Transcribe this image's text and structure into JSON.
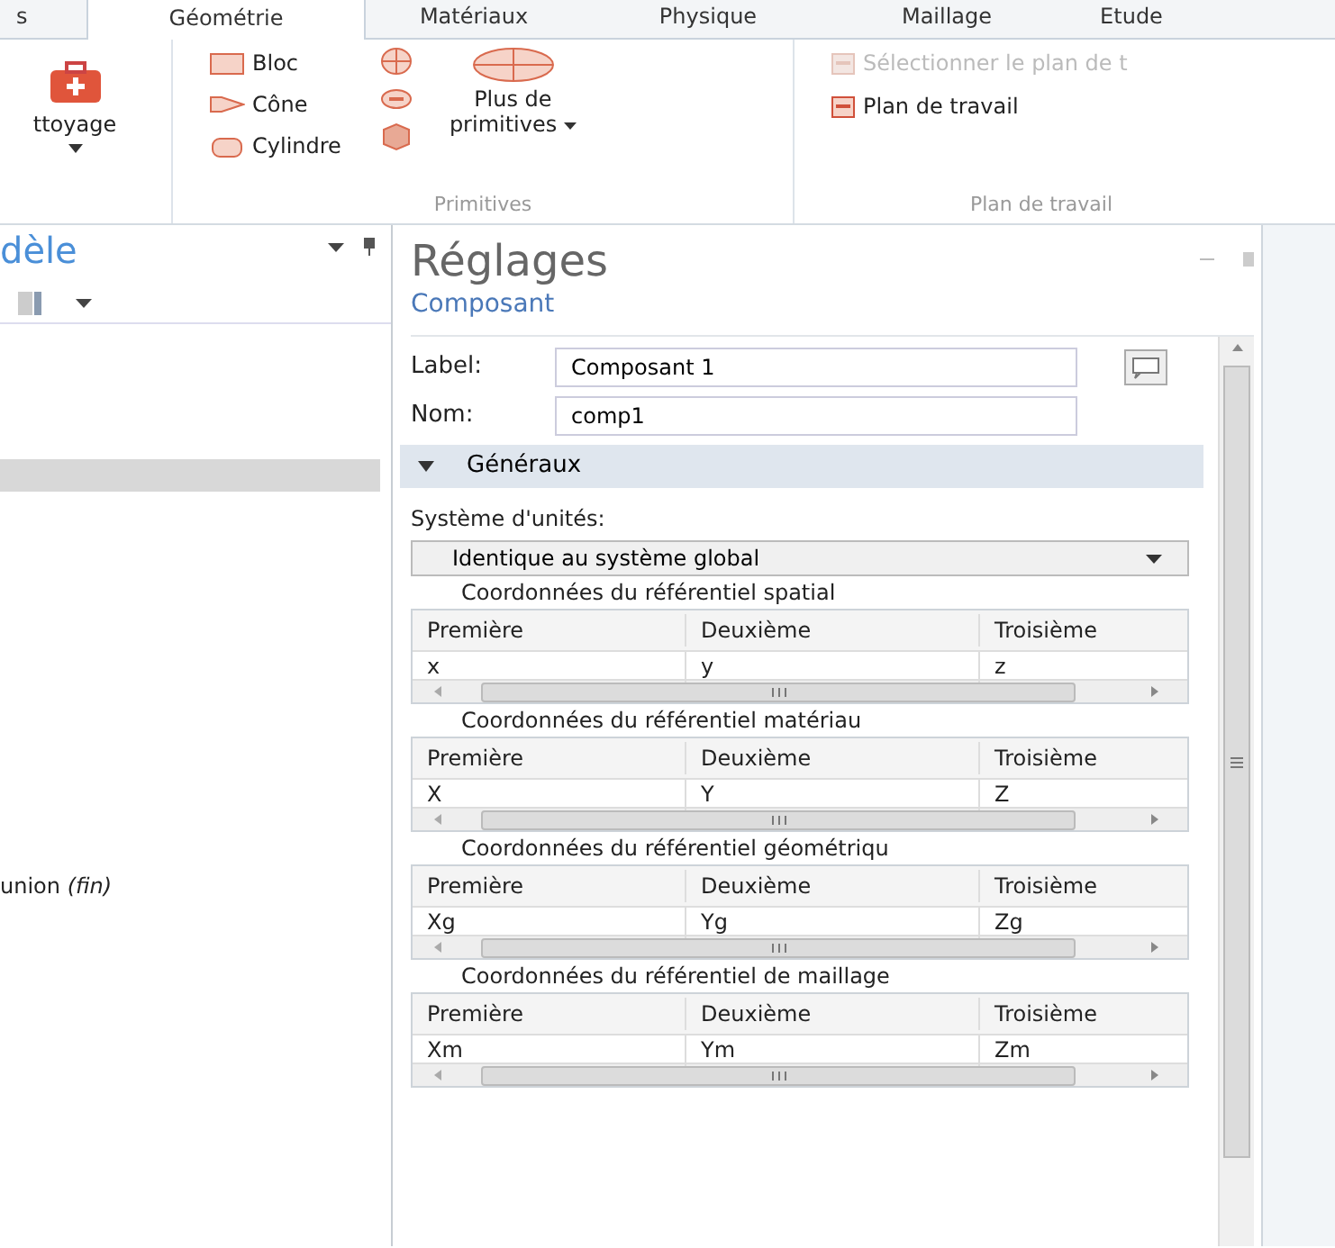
{
  "ribbon_tabs": [
    {
      "label": "s",
      "selected": false
    },
    {
      "label": "Géométrie",
      "selected": true
    },
    {
      "label": "Matériaux",
      "selected": false
    },
    {
      "label": "Physique",
      "selected": false
    },
    {
      "label": "Maillage",
      "selected": false
    },
    {
      "label": "Etude",
      "selected": false
    }
  ],
  "cleanup_button": {
    "label": "ttoyage"
  },
  "primitives_group": {
    "items": [
      "Bloc",
      "Cône",
      "Cylindre"
    ],
    "more_button": [
      "Plus de",
      "primitives"
    ],
    "label": "Primitives"
  },
  "workplane_group": {
    "items": [
      {
        "label": "Sélectionner le plan de t",
        "disabled": true
      },
      {
        "label": "Plan de travail",
        "disabled": false
      }
    ],
    "label": "Plan de travail"
  },
  "model_panel": {
    "title": "dèle",
    "tree": [
      {
        "selected": true
      },
      {
        "label": "union *(fin)*",
        "selected": false
      }
    ]
  },
  "settings": {
    "title": "Réglages",
    "subtitle": "Composant",
    "fields": [
      {
        "label": "Label:",
        "value": "Composant 1"
      },
      {
        "label": "Nom:",
        "value": "comp1"
      }
    ],
    "section": {
      "title": "Généraux",
      "expanded": true
    },
    "unit_system": {
      "label": "Système d'unités:",
      "value": "Identique au système global"
    },
    "coordinate_tables": [
      {
        "title": "Coordonnées du référentiel spatial",
        "columns": [
          "Première",
          "Deuxième",
          "Troisième"
        ],
        "values": [
          "x",
          "y",
          "z"
        ]
      },
      {
        "title": "Coordonnées du référentiel matériau",
        "columns": [
          "Première",
          "Deuxième",
          "Troisième"
        ],
        "values": [
          "X",
          "Y",
          "Z"
        ]
      },
      {
        "title": "Coordonnées du référentiel géométriqu",
        "columns": [
          "Première",
          "Deuxième",
          "Troisième"
        ],
        "values": [
          "Xg",
          "Yg",
          "Zg"
        ]
      },
      {
        "title": "Coordonnées du référentiel de maillage",
        "columns": [
          "Première",
          "Deuxième",
          "Troisième"
        ],
        "values": [
          "Xm",
          "Ym",
          "Zm"
        ]
      }
    ]
  }
}
